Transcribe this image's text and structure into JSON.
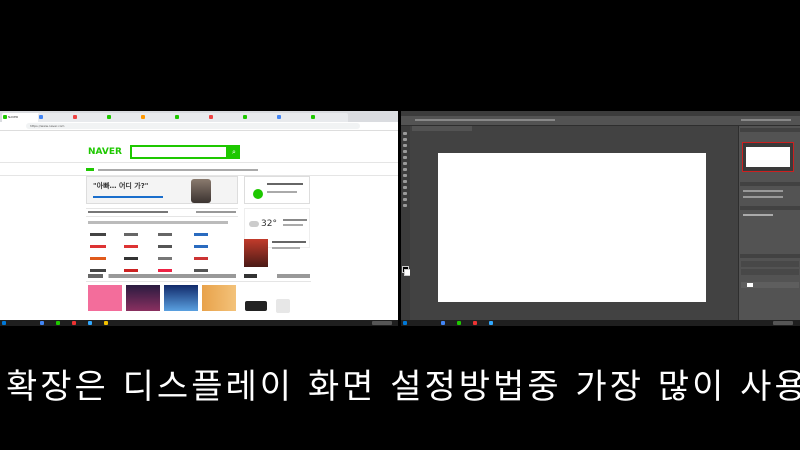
{
  "left_monitor": {
    "browser": {
      "tabs": [
        {
          "label": "NAVER",
          "active": true
        },
        {
          "label": "",
          "active": false
        },
        {
          "label": "",
          "active": false
        },
        {
          "label": "",
          "active": false
        },
        {
          "label": "",
          "active": false
        },
        {
          "label": "",
          "active": false
        },
        {
          "label": "",
          "active": false
        },
        {
          "label": "",
          "active": false
        },
        {
          "label": "",
          "active": false
        },
        {
          "label": "",
          "active": false
        }
      ],
      "url": "https://www.naver.com"
    },
    "naver": {
      "logo": "NAVER",
      "search_icon": "search-icon",
      "brand_color": "#1EC800",
      "banner": {
        "headline": "\"아빠… 어디 가?\""
      },
      "weather": {
        "temperature": "32°"
      }
    }
  },
  "right_monitor": {
    "photoshop": {
      "canvas_color": "#FFFFFF",
      "selection_color": "#CC2020"
    }
  },
  "subtitle": "확장은 디스플레이 화면 설정방법중 가장 많이 사용되는 방법입니다."
}
